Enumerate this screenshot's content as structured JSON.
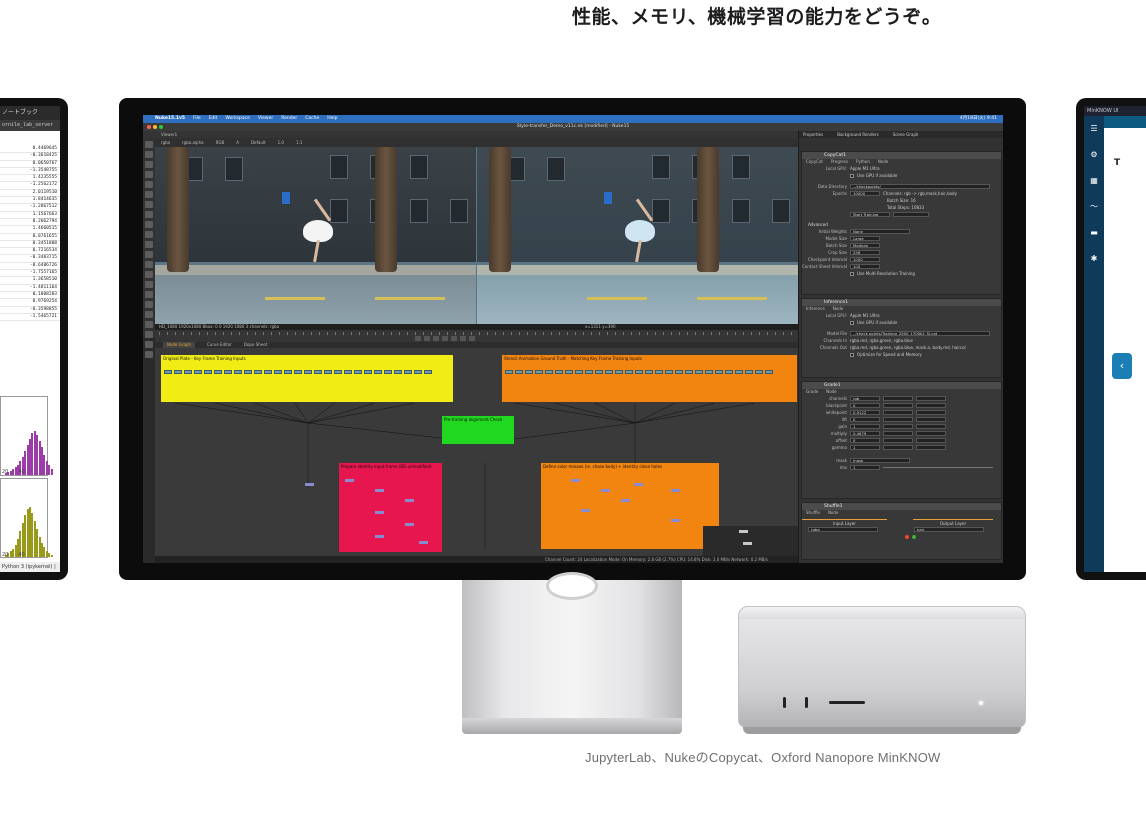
{
  "headline": "性能、メモリ、機械学習の能力をどうぞ。",
  "caption": "JupyterLab、NukeのCopycat、Oxford Nanopore MinKNOW",
  "left_device": {
    "title": "ノートブック",
    "server": "ornile_lab_server",
    "values": [
      "0.4469645",
      "-0.3618425",
      "0.0650767",
      "-1.3548755",
      "1.4235555",
      "-1.2562172",
      "2.0119510",
      "1.8414635",
      "-1.2867512",
      "1.1567663",
      "0.2662794",
      "1.4660515",
      "0.0761655",
      "0.3451888",
      "0.7216534",
      "-0.3483715",
      "-0.6486726",
      "-1.7557165",
      "1.3658510",
      "-1.4811164",
      "0.1008283",
      "0.9769254",
      "-0.3598855",
      "-1.5465721"
    ],
    "hist_ticks_1": [
      "20",
      "40"
    ],
    "hist_ticks_2": [
      "20",
      "40"
    ],
    "footer": "Python 3 (ipykernel) | Idle"
  },
  "right_device": {
    "app": "MinKNOW UI",
    "heading": "T",
    "arrow": "‹"
  },
  "nuke": {
    "menubar": [
      "Nuke15.1v5",
      "File",
      "Edit",
      "Workspace",
      "Viewer",
      "Render",
      "Cache",
      "Help"
    ],
    "clock": "4月18日(火) 9:41",
    "window_title": "Style-transfer_Demo_v11c.nk [modified] - Nuke15",
    "viewer_tab": "Viewer1",
    "viewer_controls": [
      "rgba",
      "rgba.alpha",
      "RGB",
      "A",
      "Default",
      "1.0",
      "1:1"
    ],
    "viewer_info": "HD_1080 1920x1080  Bbox: 0 0 1920 1080 3 channels: rgba",
    "viewer_coords": "x=1311 y=390",
    "graph_tabs": [
      "Node Graph",
      "Curve Editor",
      "Dope Sheet"
    ],
    "backdrops": {
      "yellow": "Original Plate - Key Frame Training Inputs",
      "orange1": "Stencil Animation Ground Truth - Matching Key Frame Training Inputs",
      "green": "Pre-training alignment Check",
      "pink": "Prepare identity input frame (BG unmodified)",
      "orange2": "Define color masses (ie. chase body) + identity clean holes"
    },
    "status": "Channel Count: 24  Localization Mode: On  Memory: 2.8 GB (2.7%)  CPU: 14.8%  Disk: 3.0 MB/s  Network: 0.2 MB/s",
    "props_tabs": [
      "Properties",
      "Background Renders",
      "Scene Graph"
    ],
    "copycat": {
      "name": "CopyCat1",
      "tabs": [
        "CopyCat",
        "Progress",
        "Python",
        "Node"
      ],
      "local_gpu": "Apple M1 Ultra",
      "use_gpu": "Use GPU if available",
      "data_dir": "../checkpoints/",
      "epochs": "10000",
      "channels": "Channels: rgb -> rgb,mask,hair,body",
      "batch": "Batch Size: 16",
      "total": "Total Steps: 10833",
      "start": "Start Training",
      "advanced": "Advanced",
      "initial_weights": "None",
      "model_size": "Large",
      "batch_size": "Medium",
      "crop_size": "256",
      "checkpoint_interval": "1000",
      "contact_sheet_interval": "100",
      "multires": "Use Multi-Resolution Training"
    },
    "inference": {
      "name": "Inference1",
      "tabs": [
        "Inference",
        "Node"
      ],
      "local_gpu": "Apple M1 Ultra",
      "use_gpu": "Use GPU if available",
      "model_file": "../check points/Training_2500_1700k2_Sl.cat",
      "channels_in": "rgba.red, rgba.green, rgba.blue",
      "channels_out": "rgba.red, rgba.green, rgba.blue, mask.a, body.red, haircol",
      "optimize": "Optimize for Speed and Memory"
    },
    "grade": {
      "name": "Grade1",
      "tabs": [
        "Grade",
        "Node"
      ],
      "channels": "rgb",
      "rows": [
        {
          "label": "channels",
          "v": "rgb"
        },
        {
          "label": "blackpoint",
          "v": "0"
        },
        {
          "label": "whitepoint",
          "v": "0.9122"
        },
        {
          "label": "lift",
          "v": "0"
        },
        {
          "label": "gain",
          "v": "1"
        },
        {
          "label": "multiply",
          "v": "0.4679"
        },
        {
          "label": "offset",
          "v": "0"
        },
        {
          "label": "gamma",
          "v": "1"
        }
      ],
      "mask": "mask",
      "mix": "1"
    },
    "shuffle": {
      "name": "Shuffle1",
      "tabs": [
        "Shuffle",
        "Node"
      ],
      "input_layer": "Input Layer",
      "output_layer": "Output Layer",
      "in": "rgba",
      "out": "hair"
    }
  },
  "colors": {
    "yellow": "#f0ec14",
    "orange": "#f28410",
    "green": "#21d820",
    "pink": "#e8164e",
    "menubar": "#2f6fc0"
  }
}
